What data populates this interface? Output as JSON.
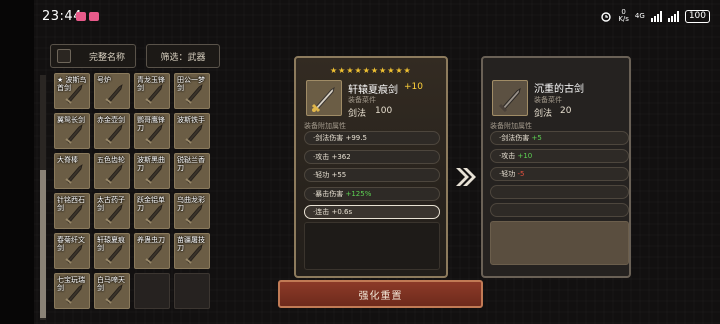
{
  "status_bar": {
    "time": "23:44",
    "net_speed_value": "0",
    "net_speed_unit": "K/s",
    "network": "4G",
    "battery": "100"
  },
  "toolbar": {
    "name_toggle_label": "完整名称",
    "filter_label": "筛选：武器"
  },
  "weapons": [
    {
      "name": "★ 波斯鸟首剑"
    },
    {
      "name": "号炉"
    },
    {
      "name": "青龙玉锋剑"
    },
    {
      "name": "田公一梦剑"
    },
    {
      "name": "翼鸳长剑"
    },
    {
      "name": "赤金壶剑"
    },
    {
      "name": "鹦哥鹰锋刀"
    },
    {
      "name": "波斯铁手"
    },
    {
      "name": "大脊棒"
    },
    {
      "name": "五色齿轮"
    },
    {
      "name": "波斯黑曲刀"
    },
    {
      "name": "锐鞑兰香刀"
    },
    {
      "name": "针铭西石剑"
    },
    {
      "name": "太古药子剑"
    },
    {
      "name": "跃金铝单刀"
    },
    {
      "name": "乌曲龙彩刀"
    },
    {
      "name": "春菊纤文剑"
    },
    {
      "name": "轩辕夏痕剑"
    },
    {
      "name": "养蛊虫刀"
    },
    {
      "name": "苗疆屠技刀"
    },
    {
      "name": "七宝玩瑞剑"
    },
    {
      "name": "白马啼天剑"
    },
    {
      "name": ""
    },
    {
      "name": ""
    }
  ],
  "current_weapon": {
    "stars": 10,
    "name": "轩辕夏痕剑",
    "enhance_level": "+10",
    "material": "装备菜件",
    "skill_label": "剑法",
    "skill_value": "100",
    "attr_header": "装备附加属性",
    "attrs": [
      {
        "label": "·剑法伤害",
        "value": "+99.5",
        "bonus": ""
      },
      {
        "label": "·攻击",
        "value": "+362",
        "bonus": ""
      },
      {
        "label": "·轻功",
        "value": "+55",
        "bonus": ""
      },
      {
        "label": "·暴击伤害",
        "value": "",
        "bonus": "+125%"
      },
      {
        "label": "·连击",
        "value": "+0.6s",
        "bonus": ""
      }
    ]
  },
  "compare_weapon": {
    "name": "沉重的古剑",
    "material": "装备菜件",
    "skill_label": "剑法",
    "skill_value": "20",
    "attr_header": "装备附加属性",
    "attrs": [
      {
        "label": "·剑法伤害",
        "value": "+5",
        "color": "#5dd153"
      },
      {
        "label": "·攻击",
        "value": "+10",
        "color": "#5dd153"
      },
      {
        "label": "·轻功",
        "value": "-5",
        "color": "#e2503f"
      }
    ]
  },
  "actions": {
    "enhance_label": "强化重置"
  },
  "colors": {
    "accent_gold": "#f1c232",
    "positive": "#5dd153",
    "negative": "#e2503f",
    "button_red": "#8c3a28"
  }
}
